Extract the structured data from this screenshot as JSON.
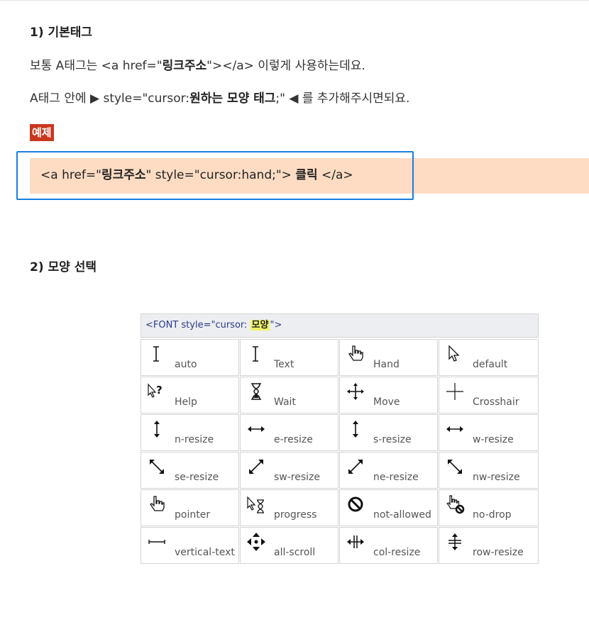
{
  "section1": {
    "heading": "1) 기본태그",
    "line1_pre": "보통 A태그는 <a href=\"",
    "line1_bold": "링크주소",
    "line1_post": "\"></a>  이렇게 사용하는데요.",
    "line2_pre": "A태그 안에 ▶ style=\"cursor:",
    "line2_bold": "원하는 모양 태그",
    "line2_post": ";\" ◀  를 추가해주시면되요.",
    "example_badge": "예제",
    "code_pre": "<a href=\"",
    "code_bold1": "링크주소",
    "code_mid": "\" style=\"cursor:hand;\"> ",
    "code_bold2": "클릭",
    "code_post": " </a>"
  },
  "section2": {
    "heading": "2) 모양 선택"
  },
  "cursor_table": {
    "title_pre": "<FONT style=\"cursor: ",
    "title_highlight": "모양",
    "title_post": "\">",
    "cells": [
      {
        "icon": "text-beam-icon",
        "label": "auto"
      },
      {
        "icon": "text-beam-icon",
        "label": "Text"
      },
      {
        "icon": "hand-icon",
        "label": "Hand"
      },
      {
        "icon": "arrow-icon",
        "label": "default"
      },
      {
        "icon": "help-icon",
        "label": "Help"
      },
      {
        "icon": "hourglass-icon",
        "label": "Wait"
      },
      {
        "icon": "move-icon",
        "label": "Move"
      },
      {
        "icon": "crosshair-icon",
        "label": "Crosshair"
      },
      {
        "icon": "vertical-resize-icon",
        "label": "n-resize"
      },
      {
        "icon": "horizontal-resize-icon",
        "label": "e-resize"
      },
      {
        "icon": "vertical-resize-icon",
        "label": "s-resize"
      },
      {
        "icon": "horizontal-resize-icon",
        "label": "w-resize"
      },
      {
        "icon": "diagonal-se-icon",
        "label": "se-resize"
      },
      {
        "icon": "diagonal-sw-icon",
        "label": "sw-resize"
      },
      {
        "icon": "diagonal-sw-icon",
        "label": "ne-resize"
      },
      {
        "icon": "diagonal-se-icon",
        "label": "nw-resize"
      },
      {
        "icon": "hand-icon",
        "label": "pointer"
      },
      {
        "icon": "progress-icon",
        "label": "progress"
      },
      {
        "icon": "not-allowed-icon",
        "label": "not-allowed"
      },
      {
        "icon": "no-drop-icon",
        "label": "no-drop"
      },
      {
        "icon": "vertical-text-icon",
        "label": "vertical-text"
      },
      {
        "icon": "all-scroll-icon",
        "label": "all-scroll"
      },
      {
        "icon": "col-resize-icon",
        "label": "col-resize"
      },
      {
        "icon": "row-resize-icon",
        "label": "row-resize"
      }
    ]
  }
}
